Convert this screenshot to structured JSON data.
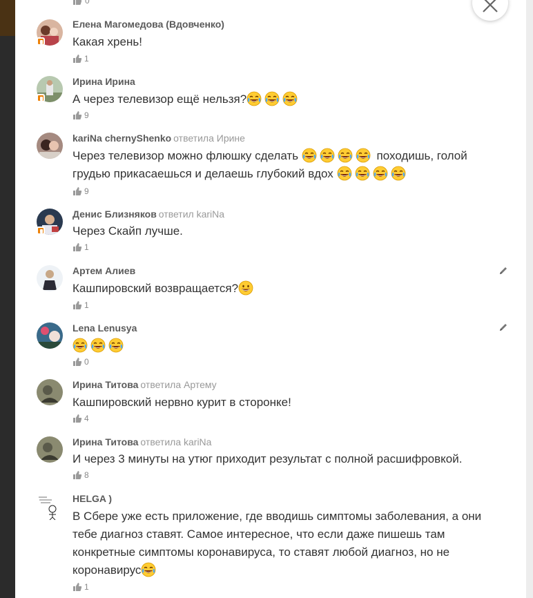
{
  "top_like_count": "0",
  "comments": [
    {
      "author": "Елена Магомедова (Вдовченко)",
      "reply": "",
      "reply_to": "",
      "text": "Какая хрень!",
      "emojis": [],
      "likes": "1",
      "mobile": true
    },
    {
      "author": "Ирина Ирина",
      "reply": "",
      "reply_to": "",
      "text": "А через телевизор ещё нельзя?",
      "emojis": [
        "laugh-cry",
        "laugh-cry",
        "laugh-cry"
      ],
      "likes": "9",
      "mobile": true
    },
    {
      "author": "kariNa chernyShenko",
      "reply": "ответила",
      "reply_to": "Ирине",
      "text": "Через телевизор можно флюшку сделать",
      "text2": "походишь, голой",
      "text3": "грудью прикасаешься и делаешь глубокий вдох",
      "likes": "9",
      "mobile": false
    },
    {
      "author": "Денис Близняков",
      "reply": "ответил",
      "reply_to": "kariNa",
      "text": "Через Скайп лучше.",
      "emojis": [],
      "likes": "1",
      "mobile": true
    },
    {
      "author": "Артем Алиев",
      "reply": "",
      "reply_to": "",
      "text": "Кашпировский возвращается?",
      "emojis": [
        "grin"
      ],
      "likes": "1",
      "mobile": false
    },
    {
      "author": "Lena Lenusya",
      "reply": "",
      "reply_to": "",
      "text": "",
      "emojis": [
        "laugh-cry",
        "laugh-cry",
        "laugh-cry"
      ],
      "likes": "0",
      "mobile": false
    },
    {
      "author": "Ирина Титова",
      "reply": "ответила",
      "reply_to": "Артему",
      "text": "Кашпировский нервно курит в сторонке!",
      "emojis": [],
      "likes": "4",
      "mobile": false
    },
    {
      "author": "Ирина Титова",
      "reply": "ответила",
      "reply_to": "kariNa",
      "text": "И через 3 минуты на утюг приходит результат с полной расшифровкой.",
      "emojis": [],
      "likes": "8",
      "mobile": false
    },
    {
      "author": "HELGA )",
      "reply": "",
      "reply_to": "",
      "text_lines": [
        "В Сбере уже есть приложение, где вводишь симптомы заболевания, а они",
        "тебе диагноз ставят. Самое интересное, что если даже пишешь там",
        "конкретные симптомы коронавируса, то ставят любой диагноз, но не",
        "коронавирус"
      ],
      "emojis": [
        "laugh-cry"
      ],
      "likes": "1",
      "mobile": false
    }
  ],
  "colors": {
    "accent": "#ee8208",
    "author": "#5a5a5a",
    "muted": "#999999",
    "text": "#333333"
  },
  "icons": {
    "like": "thumbs-up-icon",
    "close": "close-icon",
    "edit": "pencil-icon",
    "mobile": "mobile-badge-icon"
  }
}
